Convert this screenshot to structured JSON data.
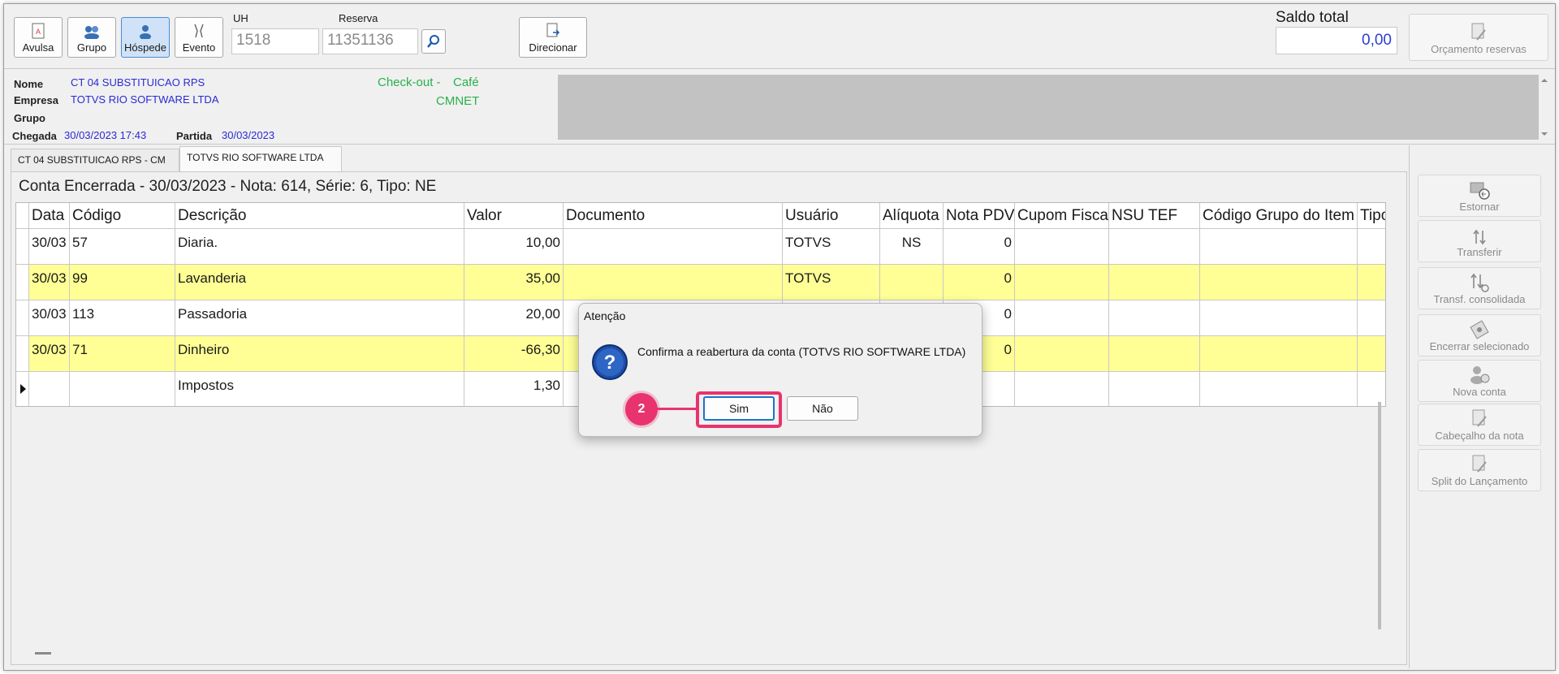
{
  "toolbar": {
    "buttons": [
      {
        "label": "Avulsa",
        "icon": "document-a-icon"
      },
      {
        "label": "Grupo",
        "icon": "group-icon"
      },
      {
        "label": "Hóspede",
        "icon": "person-icon"
      },
      {
        "label": "Evento",
        "icon": "event-icon"
      }
    ],
    "uh_label": "UH",
    "uh_value": "1518",
    "reserva_label": "Reserva",
    "reserva_value": "11351136",
    "direcionar_label": "Direcionar",
    "saldo_label": "Saldo total",
    "saldo_value": "0,00",
    "orcamento_label": "Orçamento reservas"
  },
  "info": {
    "nome_label": "Nome",
    "nome_value": "CT 04 SUBSTITUICAO RPS",
    "empresa_label": "Empresa",
    "empresa_value": "TOTVS RIO SOFTWARE LTDA",
    "grupo_label": "Grupo",
    "chegada_label": "Chegada",
    "chegada_value": "30/03/2023 17:43",
    "partida_label": "Partida",
    "partida_value": "30/03/2023",
    "checkout_text": "Check-out -",
    "cafe_text": "Café",
    "cmnet_text": "CMNET"
  },
  "tabs": [
    {
      "label": "CT 04 SUBSTITUICAO RPS - CM"
    },
    {
      "label": "TOTVS RIO SOFTWARE LTDA"
    }
  ],
  "section_title": "Conta Encerrada - 30/03/2023 - Nota: 614, Série: 6, Tipo: NE",
  "table": {
    "headers": [
      "Data",
      "Código",
      "Descrição",
      "Valor",
      "Documento",
      "Usuário",
      "Alíquota",
      "Nota PDV",
      "Cupom Fiscal",
      "NSU TEF",
      "Código Grupo do Item",
      "Tipo"
    ],
    "rows": [
      {
        "data": "30/03",
        "codigo": "57",
        "descricao": "Diaria.",
        "valor": "10,00",
        "documento": "",
        "usuario": "TOTVS",
        "aliquota": "NS",
        "nota_pdv": "0"
      },
      {
        "data": "30/03",
        "codigo": "99",
        "descricao": "Lavanderia",
        "valor": "35,00",
        "documento": "",
        "usuario": "TOTVS",
        "aliquota": "",
        "nota_pdv": "0"
      },
      {
        "data": "30/03",
        "codigo": "113",
        "descricao": "Passadoria",
        "valor": "20,00",
        "documento": "",
        "usuario": "",
        "aliquota": "",
        "nota_pdv": "0"
      },
      {
        "data": "30/03",
        "codigo": "71",
        "descricao": "Dinheiro",
        "valor": "-66,30",
        "documento": "",
        "usuario": "",
        "aliquota": "",
        "nota_pdv": "0"
      },
      {
        "data": "",
        "codigo": "",
        "descricao": "Impostos",
        "valor": "1,30",
        "documento": "",
        "usuario": "",
        "aliquota": "",
        "nota_pdv": ""
      }
    ]
  },
  "side_actions": [
    {
      "label": "Estornar"
    },
    {
      "label": "Transferir"
    },
    {
      "label": "Transf. consolidada"
    },
    {
      "label": "Encerrar selecionado"
    },
    {
      "label": "Nova conta"
    },
    {
      "label": "Cabeçalho da nota"
    },
    {
      "label": "Split do Lançamento"
    }
  ],
  "dialog": {
    "title": "Atenção",
    "message": "Confirma a reabertura da conta (TOTVS RIO SOFTWARE LTDA)",
    "yes_label": "Sim",
    "no_label": "Não"
  },
  "callout": {
    "step": "2"
  },
  "colors": {
    "highlight_row": "#ffff96",
    "link_blue": "#2a2ad6",
    "status_green": "#29b14a",
    "callout_pink": "#e8336e",
    "saldo_blue": "#2a3fd0"
  }
}
